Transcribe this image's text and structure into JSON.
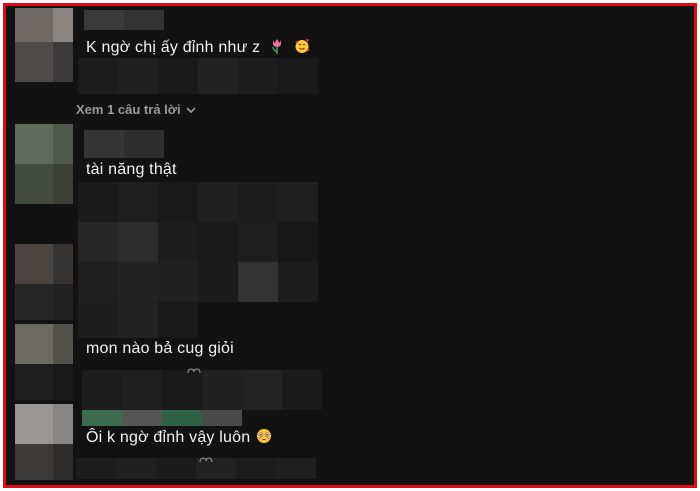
{
  "comments": [
    {
      "text": "K ngờ chị ấy đỉnh như z",
      "emojis": [
        "tulip-emoji",
        "smiling-face-with-hearts-emoji"
      ]
    },
    {
      "text": "tài năng thật",
      "emojis": []
    },
    {
      "text": "mon nào bả cug giỏi",
      "emojis": []
    },
    {
      "text": "Ôi k ngờ đỉnh vậy luôn",
      "emojis": [
        "flushed-face-emoji"
      ]
    }
  ],
  "replies": {
    "label": "Xem 1 câu trả lời",
    "icon": "chevron-down-icon"
  },
  "colors": {
    "frame_border": "#e00914",
    "background": "#121212",
    "reply_text": "#9a9a9a"
  }
}
